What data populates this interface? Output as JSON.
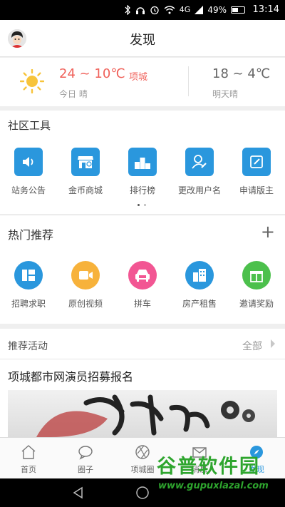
{
  "status_bar": {
    "network": "4G",
    "battery": "49%",
    "battery_level": 0.49,
    "time": "13:14"
  },
  "header": {
    "title": "发现"
  },
  "weather": {
    "today_temp": "24 ~ 10℃",
    "city": "项城",
    "today_label": "今日 晴",
    "tomorrow_temp": "18 ~ 4℃",
    "tomorrow_label": "明天晴",
    "icon": "sun-icon"
  },
  "community_tools": {
    "title": "社区工具",
    "items": [
      {
        "label": "站务公告",
        "icon": "speaker-icon",
        "color": "#2a97dd"
      },
      {
        "label": "金币商城",
        "icon": "shop-icon",
        "color": "#2a97dd"
      },
      {
        "label": "排行榜",
        "icon": "podium-icon",
        "color": "#2a97dd"
      },
      {
        "label": "更改用户名",
        "icon": "user-edit-icon",
        "color": "#2a97dd"
      },
      {
        "label": "申请版主",
        "icon": "edit-icon",
        "color": "#2a97dd"
      }
    ],
    "page_indicator": {
      "count": 2,
      "active": 0
    }
  },
  "hot_recommend": {
    "title": "热门推荐",
    "add_label": "+",
    "items": [
      {
        "label": "招聘求职",
        "icon": "recruit-icon",
        "color": "#2a97dd"
      },
      {
        "label": "原创视频",
        "icon": "video-icon",
        "color": "#f7b23b"
      },
      {
        "label": "拼车",
        "icon": "car-icon",
        "color": "#f25693"
      },
      {
        "label": "房产租售",
        "icon": "building-icon",
        "color": "#2a97dd"
      },
      {
        "label": "邀请奖励",
        "icon": "gift-icon",
        "color": "#4cc04c"
      }
    ]
  },
  "activity": {
    "title": "推荐活动",
    "all_label": "全部",
    "headline": "项城都市网演员招募报名"
  },
  "tabbar": {
    "tabs": [
      {
        "label": "首页",
        "icon": "home-icon"
      },
      {
        "label": "圈子",
        "icon": "chat-icon"
      },
      {
        "label": "项城圈",
        "icon": "camera-aperture-icon"
      },
      {
        "label": "消息",
        "icon": "mail-icon"
      },
      {
        "label": "发现",
        "icon": "compass-icon"
      }
    ],
    "active_index": 4
  },
  "watermark": {
    "main": "谷普软件园",
    "url": "www.gupuxlazal.com"
  },
  "colors": {
    "accent": "#2a97dd",
    "weather_red": "#f0615a",
    "watermark_green": "#2ea52e"
  }
}
